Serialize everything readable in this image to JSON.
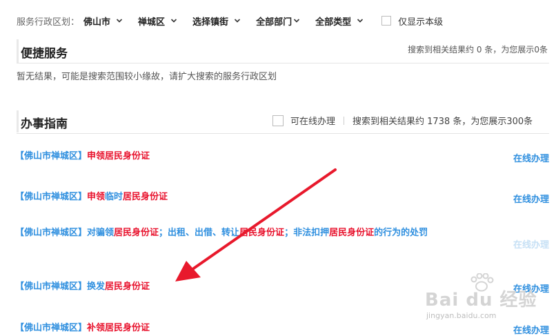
{
  "filters": {
    "label": "服务行政区划：",
    "city": "佛山市",
    "district": "禅城区",
    "town": "选择镇街",
    "department": "全部部门",
    "type": "全部类型",
    "only_this_level": "仅显示本级"
  },
  "quick_service": {
    "title": "便捷服务",
    "count_text": "搜索到相关结果约 0 条，为您展示0条",
    "empty_message": "暂无结果，可能是搜索范围较小缘故，请扩大搜索的服务行政区划"
  },
  "guide": {
    "title": "办事指南",
    "online_filter_label": "可在线办理",
    "count_text": "搜索到相关结果约 1738 条，为您展示300条",
    "items": [
      {
        "segments": [
          {
            "t": "【佛山市禅城区】"
          },
          {
            "t": "申领居民身份证",
            "hl": true
          }
        ],
        "online": "在线办理"
      },
      {
        "segments": [
          {
            "t": "【佛山市禅城区】"
          },
          {
            "t": "申领",
            "hl": true
          },
          {
            "t": "临时"
          },
          {
            "t": "居民身份证",
            "hl": true
          }
        ],
        "online": "在线办理"
      },
      {
        "segments": [
          {
            "t": "【佛山市禅城区】对骗领"
          },
          {
            "t": "居民身份证",
            "hl": true
          },
          {
            "t": "；出租、出借、转让"
          },
          {
            "t": "居民身份证",
            "hl": true
          },
          {
            "t": "；非法扣押"
          },
          {
            "t": "居民身份证",
            "hl": true
          },
          {
            "t": "的行为的处罚"
          }
        ],
        "online": "在线办理"
      },
      {
        "segments": [
          {
            "t": "【佛山市禅城区】换发"
          },
          {
            "t": "居民身份证",
            "hl": true
          }
        ],
        "online": "在线办理"
      },
      {
        "segments": [
          {
            "t": "【佛山市禅城区】"
          },
          {
            "t": "补领",
            "hl": true
          },
          {
            "t": "居民身份证",
            "hl": true
          }
        ],
        "online": "在线办理"
      }
    ]
  },
  "watermark": {
    "main": "Bai du 经验",
    "sub": "jingyan.baidu.com"
  },
  "colors": {
    "link": "#2f8fdf",
    "highlight": "#e8102b",
    "arrow": "#e8192c"
  }
}
